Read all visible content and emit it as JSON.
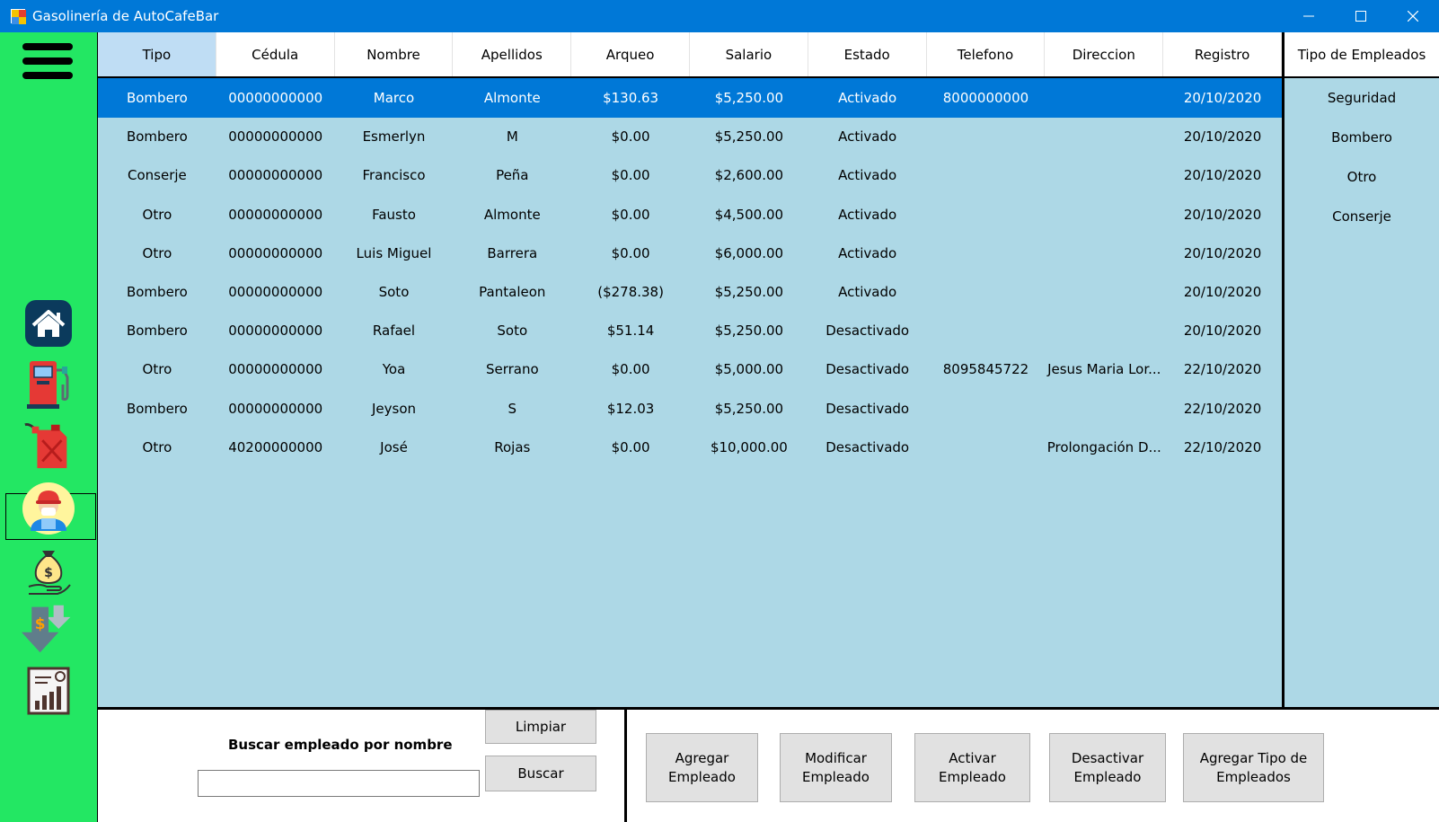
{
  "window": {
    "title": "Gasolinería de AutoCafeBar"
  },
  "sidebar": {
    "items": [
      {
        "icon": "home-icon"
      },
      {
        "icon": "fuel-pump-icon"
      },
      {
        "icon": "fuel-can-icon"
      },
      {
        "icon": "employee-icon",
        "selected": true
      },
      {
        "icon": "money-hand-icon"
      },
      {
        "icon": "expense-down-icon"
      },
      {
        "icon": "report-chart-icon"
      }
    ]
  },
  "grid": {
    "columns": [
      "Tipo",
      "Cédula",
      "Nombre",
      "Apellidos",
      "Arqueo",
      "Salario",
      "Estado",
      "Telefono",
      "Direccion",
      "Registro"
    ],
    "rows": [
      [
        "Bombero",
        "00000000000",
        "Marco",
        "Almonte",
        "$130.63",
        "$5,250.00",
        "Activado",
        "8000000000",
        "",
        "20/10/2020"
      ],
      [
        "Bombero",
        "00000000000",
        "Esmerlyn",
        "M",
        "$0.00",
        "$5,250.00",
        "Activado",
        "",
        "",
        "20/10/2020"
      ],
      [
        "Conserje",
        "00000000000",
        "Francisco",
        "Peña",
        "$0.00",
        "$2,600.00",
        "Activado",
        "",
        "",
        "20/10/2020"
      ],
      [
        "Otro",
        "00000000000",
        "Fausto",
        "Almonte",
        "$0.00",
        "$4,500.00",
        "Activado",
        "",
        "",
        "20/10/2020"
      ],
      [
        "Otro",
        "00000000000",
        "Luis Miguel",
        "Barrera",
        "$0.00",
        "$6,000.00",
        "Activado",
        "",
        "",
        "20/10/2020"
      ],
      [
        "Bombero",
        "00000000000",
        "Soto",
        "Pantaleon",
        "($278.38)",
        "$5,250.00",
        "Activado",
        "",
        "",
        "20/10/2020"
      ],
      [
        "Bombero",
        "00000000000",
        "Rafael",
        "Soto",
        "$51.14",
        "$5,250.00",
        "Desactivado",
        "",
        "",
        "20/10/2020"
      ],
      [
        "Otro",
        "00000000000",
        "Yoa",
        "Serrano",
        "$0.00",
        "$5,000.00",
        "Desactivado",
        "8095845722",
        "Jesus Maria Lor...",
        "22/10/2020"
      ],
      [
        "Bombero",
        "00000000000",
        "Jeyson",
        "S",
        "$12.03",
        "$5,250.00",
        "Desactivado",
        "",
        "",
        "22/10/2020"
      ],
      [
        "Otro",
        "40200000000",
        "José",
        "Rojas",
        "$0.00",
        "$10,000.00",
        "Desactivado",
        "",
        "Prolongación D...",
        "22/10/2020"
      ]
    ]
  },
  "types_panel": {
    "header": "Tipo de Empleados",
    "items": [
      "Seguridad",
      "Bombero",
      "Otro",
      "Conserje"
    ]
  },
  "search": {
    "label": "Buscar empleado por nombre",
    "value": "",
    "clear_label": "Limpiar",
    "search_label": "Buscar"
  },
  "actions": {
    "add": "Agregar Empleado",
    "modify": "Modificar Empleado",
    "activate": "Activar Empleado",
    "deactivate": "Desactivar Empleado",
    "add_type": "Agregar Tipo de Empleados"
  },
  "colors": {
    "titlebar": "#0078d7",
    "sidebar": "#23e763",
    "grid_background": "#add8e6",
    "selection": "#0078d7"
  }
}
